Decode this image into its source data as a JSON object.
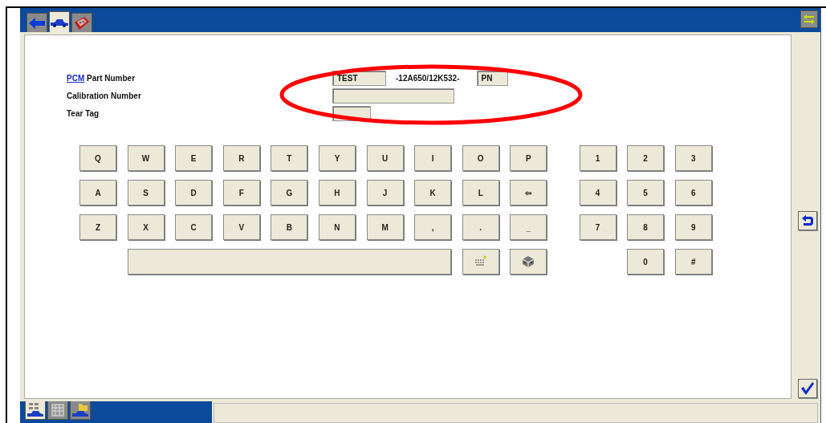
{
  "top_tabs": [
    {
      "selected": false
    },
    {
      "selected": true
    },
    {
      "selected": false
    }
  ],
  "form": {
    "part_number": {
      "link": "PCM",
      "label": "Part Number",
      "prefix": "TEST",
      "code": "-12A650/12K532-",
      "suffix": "PN"
    },
    "calibration_number": {
      "label": "Calibration Number"
    },
    "tear_tag": {
      "label": "Tear Tag"
    }
  },
  "keyboard": {
    "rows": [
      {
        "letters": [
          {
            "kind": "char",
            "label": "Q"
          },
          {
            "kind": "char",
            "label": "W"
          },
          {
            "kind": "char",
            "label": "E"
          },
          {
            "kind": "char",
            "label": "R"
          },
          {
            "kind": "char",
            "label": "T"
          },
          {
            "kind": "char",
            "label": "Y"
          },
          {
            "kind": "char",
            "label": "U"
          },
          {
            "kind": "char",
            "label": "I"
          },
          {
            "kind": "char",
            "label": "O"
          },
          {
            "kind": "char",
            "label": "P"
          }
        ],
        "digits": [
          {
            "kind": "char",
            "label": "1"
          },
          {
            "kind": "char",
            "label": "2"
          },
          {
            "kind": "char",
            "label": "3"
          }
        ]
      },
      {
        "letters": [
          {
            "kind": "char",
            "label": "A"
          },
          {
            "kind": "char",
            "label": "S"
          },
          {
            "kind": "char",
            "label": "D"
          },
          {
            "kind": "char",
            "label": "F"
          },
          {
            "kind": "char",
            "label": "G"
          },
          {
            "kind": "char",
            "label": "H"
          },
          {
            "kind": "char",
            "label": "J"
          },
          {
            "kind": "char",
            "label": "K"
          },
          {
            "kind": "char",
            "label": "L"
          },
          {
            "kind": "char",
            "label": "⇦"
          }
        ],
        "digits": [
          {
            "kind": "char",
            "label": "4"
          },
          {
            "kind": "char",
            "label": "5"
          },
          {
            "kind": "char",
            "label": "6"
          }
        ]
      },
      {
        "letters": [
          {
            "kind": "char",
            "label": "Z"
          },
          {
            "kind": "char",
            "label": "X"
          },
          {
            "kind": "char",
            "label": "C"
          },
          {
            "kind": "char",
            "label": "V"
          },
          {
            "kind": "char",
            "label": "B"
          },
          {
            "kind": "char",
            "label": "N"
          },
          {
            "kind": "char",
            "label": "M"
          },
          {
            "kind": "char",
            "label": ","
          },
          {
            "kind": "char",
            "label": "."
          },
          {
            "kind": "char",
            "label": "_"
          }
        ],
        "digits": [
          {
            "kind": "char",
            "label": "7"
          },
          {
            "kind": "char",
            "label": "8"
          },
          {
            "kind": "char",
            "label": "9"
          }
        ]
      },
      {
        "letters": [
          {
            "kind": "spacebar"
          },
          {
            "kind": "keyboard"
          },
          {
            "kind": "module"
          }
        ],
        "digits": [
          {
            "kind": "char",
            "label": "0"
          },
          {
            "kind": "char",
            "label": "#"
          }
        ]
      }
    ]
  },
  "bottom_tabs": [
    {
      "selected": true
    },
    {
      "selected": false
    },
    {
      "selected": false
    }
  ]
}
